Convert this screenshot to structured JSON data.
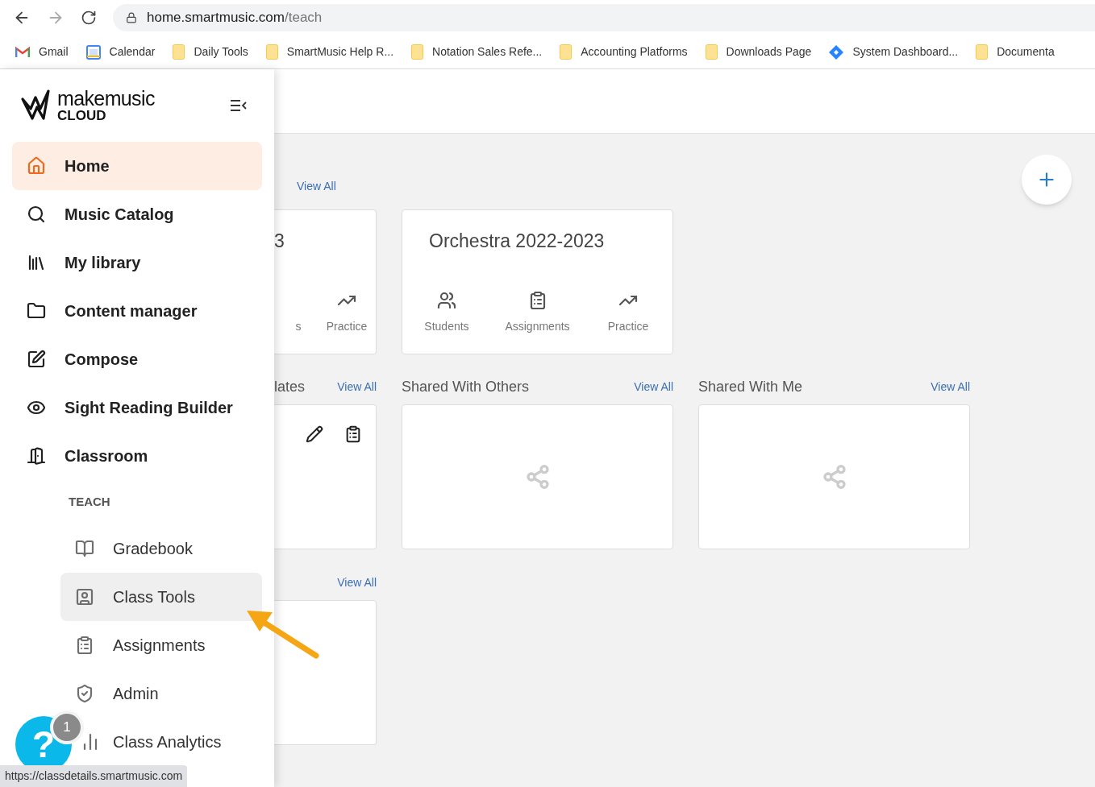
{
  "browser": {
    "url_host": "home.smartmusic.com",
    "url_path": "/teach"
  },
  "bookmarks": [
    {
      "kind": "gmail",
      "label": "Gmail"
    },
    {
      "kind": "calendar",
      "label": "Calendar"
    },
    {
      "kind": "folder",
      "label": "Daily Tools"
    },
    {
      "kind": "folder",
      "label": "SmartMusic Help R..."
    },
    {
      "kind": "folder",
      "label": "Notation Sales Refe..."
    },
    {
      "kind": "folder",
      "label": "Accounting Platforms"
    },
    {
      "kind": "folder",
      "label": "Downloads Page"
    },
    {
      "kind": "diamond",
      "label": "System Dashboard..."
    },
    {
      "kind": "folder",
      "label": "Documenta"
    }
  ],
  "sidebar": {
    "logo": {
      "name": "makemusic",
      "sub": "CLOUD"
    },
    "nav_items": [
      {
        "kind": "home",
        "label": "Home",
        "selected": true
      },
      {
        "kind": "search",
        "label": "Music Catalog",
        "selected": false
      },
      {
        "kind": "library",
        "label": "My library",
        "selected": false
      },
      {
        "kind": "folder",
        "label": "Content manager",
        "selected": false
      },
      {
        "kind": "compose",
        "label": "Compose",
        "selected": false
      },
      {
        "kind": "eye",
        "label": "Sight Reading Builder",
        "selected": false
      },
      {
        "kind": "door",
        "label": "Classroom",
        "selected": false
      }
    ],
    "section_title": "TEACH",
    "teach_items": [
      {
        "kind": "book",
        "label": "Gradebook",
        "hovered": false
      },
      {
        "kind": "badge",
        "label": "Class Tools",
        "hovered": true
      },
      {
        "kind": "clipboard",
        "label": "Assignments",
        "hovered": false
      },
      {
        "kind": "shield",
        "label": "Admin",
        "hovered": false
      },
      {
        "kind": "chart",
        "label": "Class Analytics",
        "hovered": false
      }
    ]
  },
  "classes": {
    "view_all": "View All",
    "cards": [
      {
        "title": "3",
        "actions": [
          {
            "label": "s"
          },
          {
            "kind": "practice",
            "label": "Practice"
          }
        ]
      },
      {
        "title": "Orchestra 2022-2023",
        "actions": [
          {
            "kind": "people",
            "label": "Students"
          },
          {
            "kind": "clipboard",
            "label": "Assignments"
          },
          {
            "kind": "practice",
            "label": "Practice"
          }
        ]
      }
    ]
  },
  "shared_rows": [
    {
      "title": "lates",
      "view_all": "View All",
      "kind": "templates"
    },
    {
      "title": "Shared With Others",
      "view_all": "View All",
      "kind": "shared"
    },
    {
      "title": "Shared With Me",
      "view_all": "View All",
      "kind": "shared"
    }
  ],
  "bottom_section": {
    "view_all": "View All"
  },
  "help": {
    "label": "?",
    "badge": "1"
  },
  "status_url": "https://classdetails.smartmusic.com"
}
